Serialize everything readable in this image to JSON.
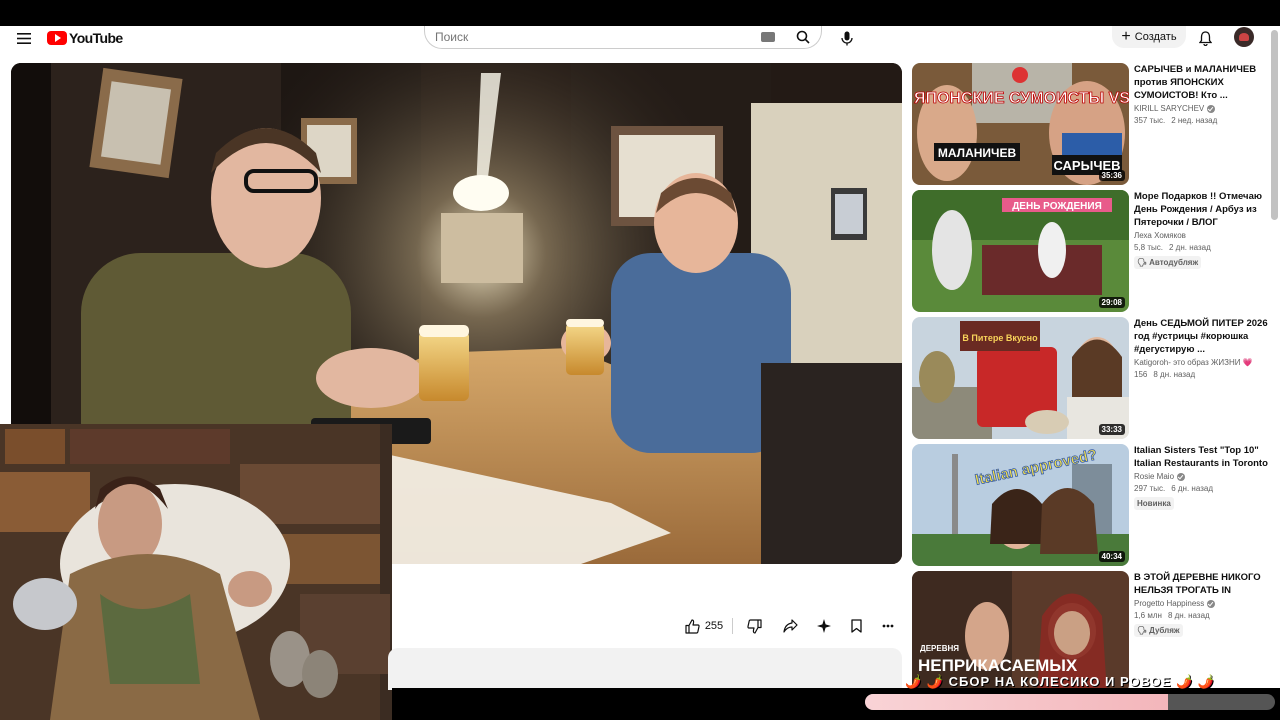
{
  "header": {
    "logo_text": "YouTube",
    "search_placeholder": "Поиск",
    "create_label": "Создать"
  },
  "actions": {
    "like_count": "255"
  },
  "recommendations": [
    {
      "title": "САРЫЧЕВ и МАЛАНИЧЕВ против ЯПОНСКИХ СУМОИСТОВ! Кто ...",
      "channel": "KIRILL SARYCHEV",
      "verified": true,
      "views": "357 тыс.",
      "age": "2 нед. назад",
      "duration": "35:36",
      "badge": "",
      "thumb_text": "ЯПОНСКИЕ СУМОИСТЫ VS",
      "thumb_text2": "МАЛАНИЧЕВ",
      "thumb_text3": "САРЫЧЕВ"
    },
    {
      "title": "Море Подарков !! Отмечаю День Рождения / Арбуз из Пятерочки / ВЛОГ",
      "channel": "Леха Хомяков",
      "verified": false,
      "views": "5,8 тыс.",
      "age": "2 дн. назад",
      "duration": "29:08",
      "badge": "Автодубляж",
      "thumb_text": "ДЕНЬ РОЖДЕНИЯ"
    },
    {
      "title": "День СЕДЬМОЙ ПИТЕР 2026 год #устрицы #корюшка #дегустирую ...",
      "channel": "Katigoroh- это образ ЖИЗНИ 💗",
      "verified": false,
      "views": "156",
      "age": "8 дн. назад",
      "duration": "33:33",
      "badge": "",
      "thumb_text": "В Питере Вкусно"
    },
    {
      "title": "Italian Sisters Test \"Top 10\" Italian Restaurants in Toronto",
      "channel": "Rosie Maio",
      "verified": true,
      "views": "297 тыс.",
      "age": "6 дн. назад",
      "duration": "40:34",
      "badge": "Новинка",
      "thumb_text": "Italian approved?"
    },
    {
      "title": "В ЭТОЙ ДЕРЕВНЕ НИКОГО НЕЛЬЗЯ ТРОГАТЬ IN",
      "channel": "Progetto Happiness",
      "verified": true,
      "views": "1,6 млн",
      "age": "8 дн. назад",
      "duration": "",
      "badge": "Дубляж",
      "thumb_text": "ДЕРЕВНЯ",
      "thumb_text2": "НЕПРИКАСАЕМЫХ"
    }
  ],
  "overlay": {
    "text": "🌶️ 🌶️ СБОР НА КОЛЕСИКО И РОВОЕ 🌶️ 🌶️",
    "progress": 0.74
  },
  "colors": {
    "brand": "#ff0000",
    "accent_pink": "#f3b6bb"
  }
}
